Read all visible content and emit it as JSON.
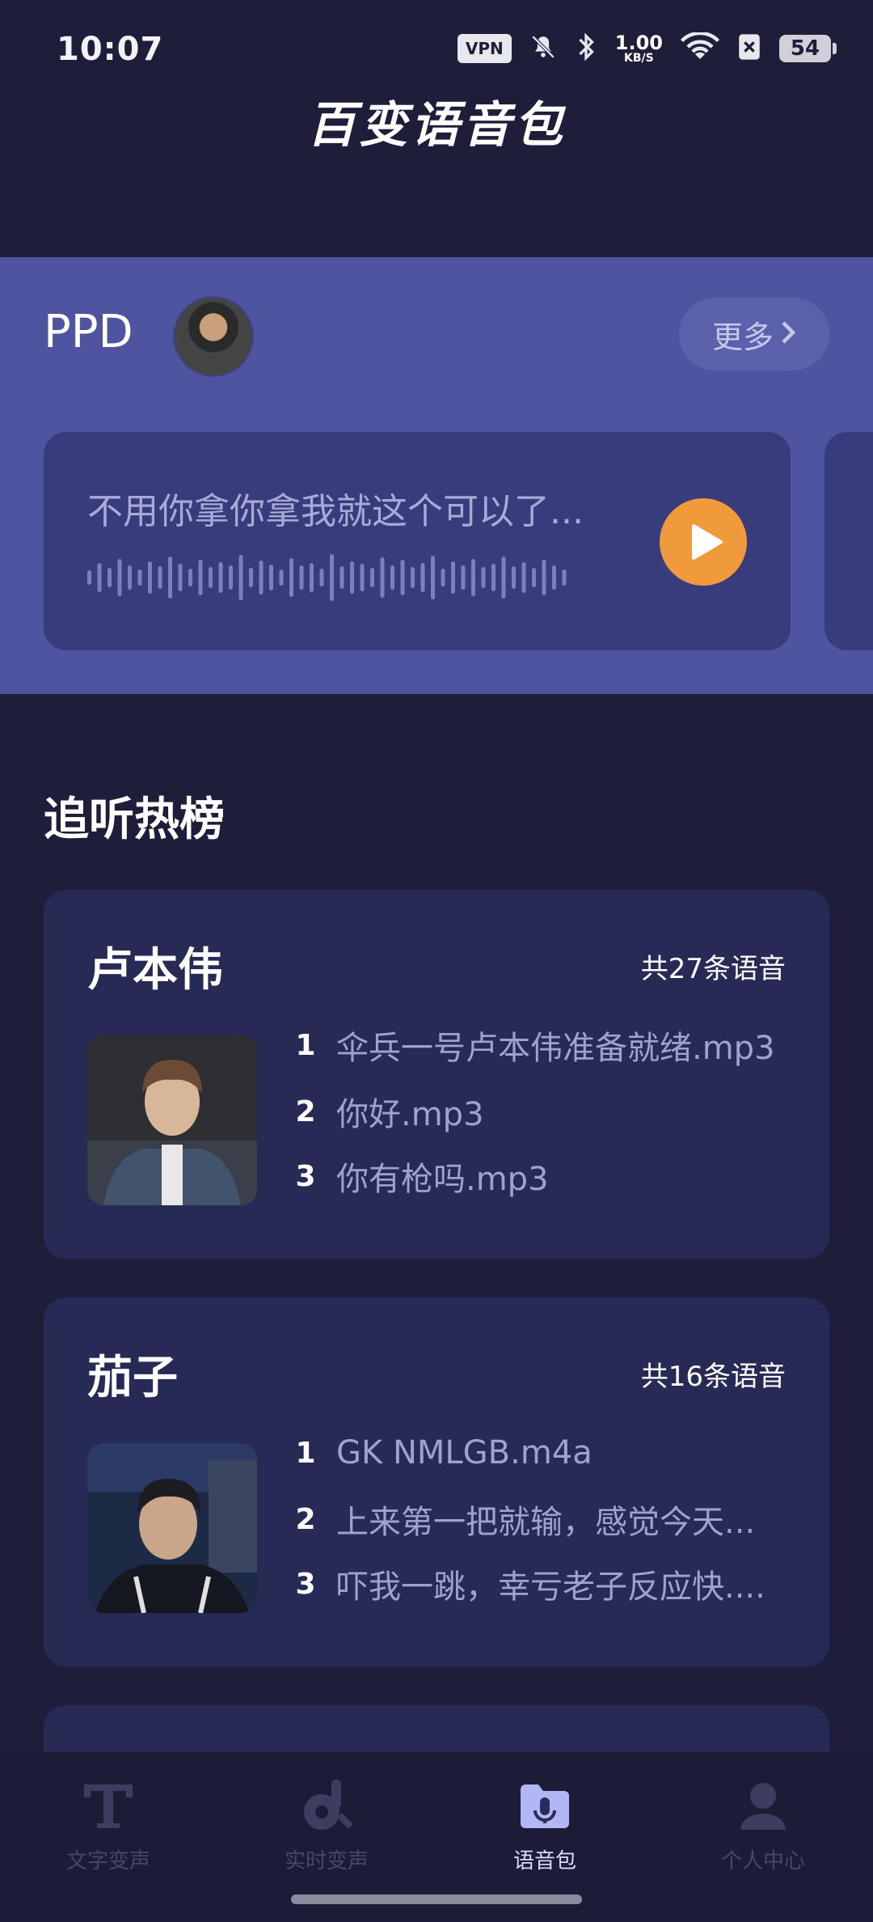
{
  "status_bar": {
    "time": "10:07",
    "vpn": "VPN",
    "speed_value": "1.00",
    "speed_unit": "KB/S",
    "battery": "54"
  },
  "app_title": "百变语音包",
  "featured": {
    "name": "PPD",
    "more_label": "更多",
    "voice_text": "不用你拿你拿我就这个可以了...",
    "accent_color": "#f09a3c"
  },
  "hot_list": {
    "title": "追听热榜",
    "cards": [
      {
        "name": "卢本伟",
        "count": "共27条语音",
        "tracks": [
          {
            "num": "1",
            "title": "伞兵一号卢本伟准备就绪.mp3"
          },
          {
            "num": "2",
            "title": "你好.mp3"
          },
          {
            "num": "3",
            "title": "你有枪吗.mp3"
          }
        ]
      },
      {
        "name": "茄子",
        "count": "共16条语音",
        "tracks": [
          {
            "num": "1",
            "title": "GK  NMLGB.m4a"
          },
          {
            "num": "2",
            "title": "上来第一把就输，感觉今天..."
          },
          {
            "num": "3",
            "title": "吓我一跳，幸亏老子反应快...."
          }
        ]
      }
    ]
  },
  "bottom_nav": {
    "items": [
      {
        "label": "文字变声",
        "icon": "text-icon"
      },
      {
        "label": "实时变声",
        "icon": "realtime-voice-icon"
      },
      {
        "label": "语音包",
        "icon": "voice-pack-icon",
        "active": true
      },
      {
        "label": "个人中心",
        "icon": "profile-icon"
      }
    ]
  }
}
